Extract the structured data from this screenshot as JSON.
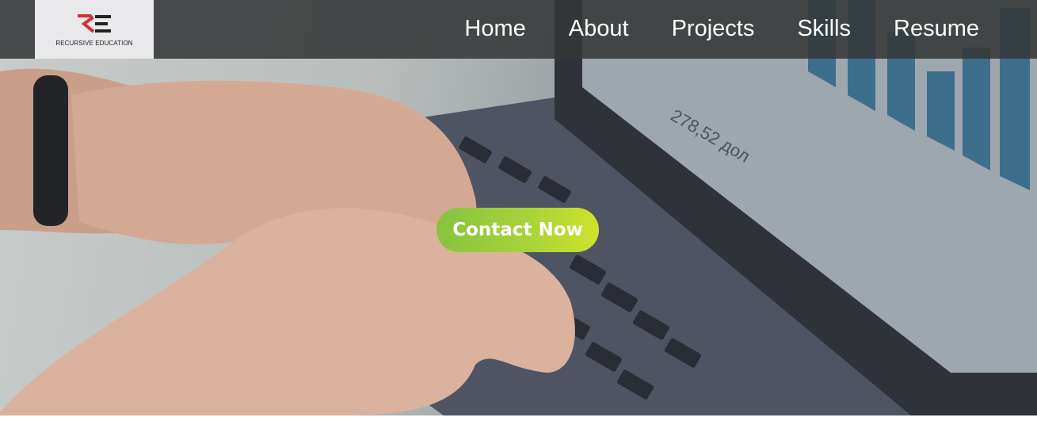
{
  "header": {
    "logo_text": "RECURSIVE EDUCATION",
    "nav": [
      {
        "label": "Home"
      },
      {
        "label": "About"
      },
      {
        "label": "Projects"
      },
      {
        "label": "Skills"
      },
      {
        "label": "Resume"
      }
    ]
  },
  "hero": {
    "image": "hands-typing-on-laptop",
    "cta_label": "Contact Now",
    "screen_text": "278,52 дол"
  },
  "colors": {
    "navbar_bg": "#343838",
    "logo_bg": "#e9e9ec",
    "logo_accent": "#d32f2f",
    "cta_start": "#86c341",
    "cta_end": "#cfe32b",
    "nav_text": "#ffffff"
  }
}
